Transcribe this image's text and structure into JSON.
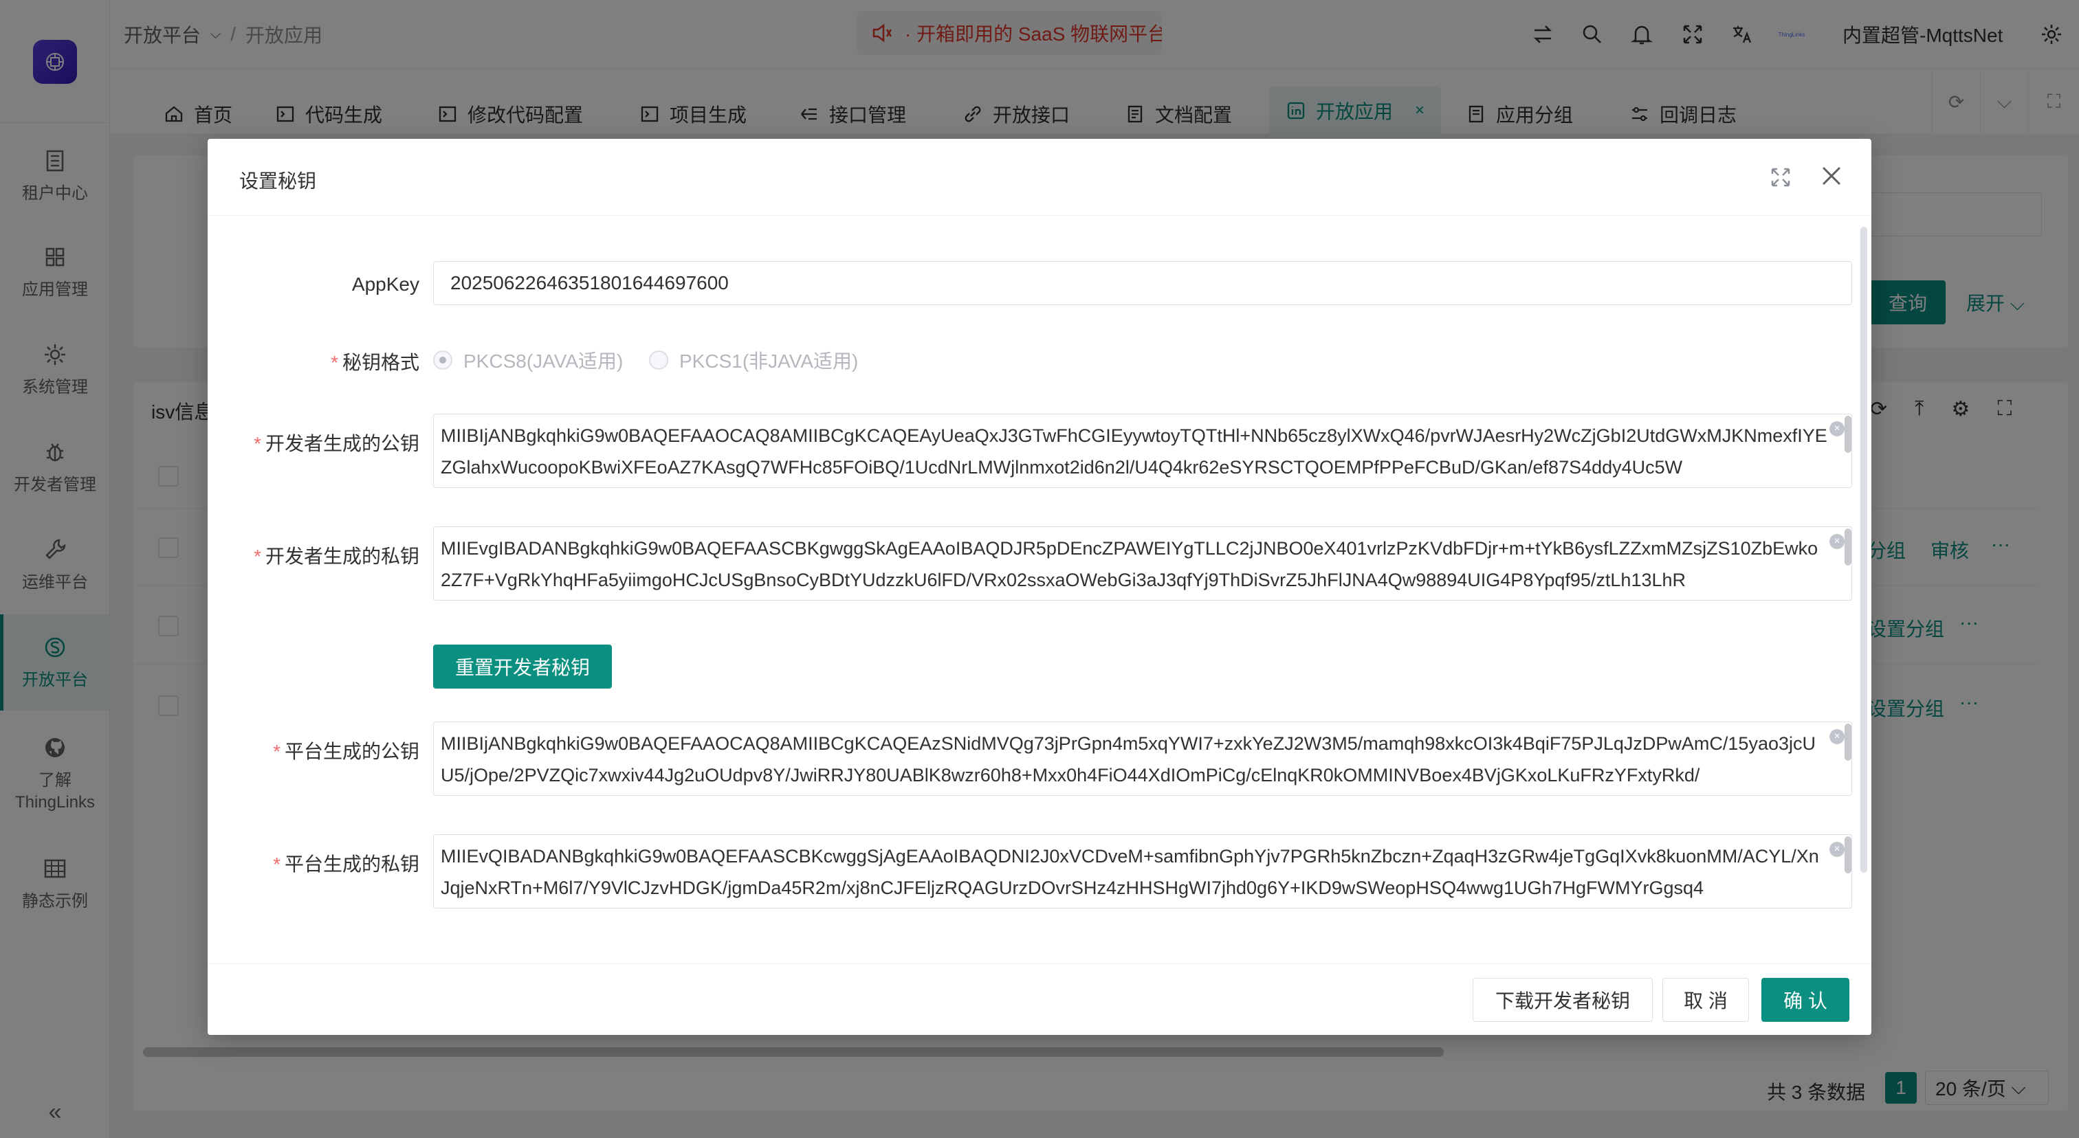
{
  "sidebar": {
    "items": [
      {
        "label": "租户中心",
        "icon": "building-icon"
      },
      {
        "label": "应用管理",
        "icon": "apps-icon"
      },
      {
        "label": "系统管理",
        "icon": "gear-icon"
      },
      {
        "label": "开发者管理",
        "icon": "bug-icon"
      },
      {
        "label": "运维平台",
        "icon": "wrench-icon"
      },
      {
        "label": "开放平台",
        "icon": "open-platform-icon"
      },
      {
        "label": "了解\nThingLinks",
        "icon": "github-icon"
      },
      {
        "label": "静态示例",
        "icon": "grid-icon"
      }
    ],
    "active_index": 5,
    "collapse_glyph": "«"
  },
  "header": {
    "breadcrumb": [
      "开放平台",
      "开放应用"
    ],
    "notice": "· 开箱即用的 SaaS 物联网平台，快速接入 · 稳定",
    "username": "内置超管-MqttsNet",
    "avatar_text": "ThingLinks"
  },
  "tabs": [
    {
      "label": "首页"
    },
    {
      "label": "代码生成"
    },
    {
      "label": "修改代码配置"
    },
    {
      "label": "项目生成"
    },
    {
      "label": "接口管理"
    },
    {
      "label": "开放接口"
    },
    {
      "label": "文档配置"
    },
    {
      "label": "开放应用",
      "active": true
    },
    {
      "label": "应用分组"
    },
    {
      "label": "回调日志"
    }
  ],
  "background": {
    "isv_title": "isv信息",
    "query_label": "查询",
    "expand_label": "展开",
    "row_links": [
      "分组",
      "审核",
      "设置分组",
      "设置分组"
    ],
    "more": "···",
    "total": "共 3 条数据",
    "page": "1",
    "page_size": "20 条/页"
  },
  "modal": {
    "title": "设置秘钥",
    "app_key_label": "AppKey",
    "app_key_value": "20250622646351801644697600",
    "format_label": "秘钥格式",
    "format_options": [
      "PKCS8(JAVA适用)",
      "PKCS1(非JAVA适用)"
    ],
    "format_selected": 0,
    "dev_public_label": "开发者生成的公钥",
    "dev_public_value": "MIIBIjANBgkqhkiG9w0BAQEFAAOCAQ8AMIIBCgKCAQEAyUeaQxJ3GTwFhCGIEyywtoyTQTtHl+NNb65cz8ylXWxQ46/pvrWJAesrHy2WcZjGbI2UtdGWxMJKNmexfIYEZGlahxWucoopoKBwiXFEoAZ7KAsgQ7WFHc85FOiBQ/1UcdNrLMWjlnmxot2id6n2l/U4Q4kr62eSYRSCTQOEMPfPPeFCBuD/GKan/ef87S4ddy4Uc5W",
    "dev_private_label": "开发者生成的私钥",
    "dev_private_value": "MIIEvgIBADANBgkqhkiG9w0BAQEFAASCBKgwggSkAgEAAoIBAQDJR5pDEncZPAWEIYgTLLC2jJNBO0eX401vrlzPzKVdbFDjr+m+tYkB6ysfLZZxmMZsjZS10ZbEwko2Z7F+VgRkYhqHFa5yiimgoHCJcUSgBnsoCyBDtYUdzzkU6lFD/VRx02ssxaOWebGi3aJ3qfYj9ThDiSvrZ5JhFlJNA4Qw98894UIG4P8Ypqf95/ztLh13LhR",
    "reset_label": "重置开发者秘钥",
    "plat_public_label": "平台生成的公钥",
    "plat_public_value": "MIIBIjANBgkqhkiG9w0BAQEFAAOCAQ8AMIIBCgKCAQEAzSNidMVQg73jPrGpn4m5xqYWI7+zxkYeZJ2W3M5/mamqh98xkcOI3k4BqiF75PJLqJzDPwAmC/15yao3jcUU5/jOpe/2PVZQic7xwxiv44Jg2uOUdpv8Y/JwiRRJY80UABlK8wzr60h8+Mxx0h4FiO44XdIOmPiCg/cElnqKR0kOMMINVBoex4BVjGKxoLKuFRzYFxtyRkd/",
    "plat_private_label": "平台生成的私钥",
    "plat_private_value": "MIIEvQIBADANBgkqhkiG9w0BAQEFAASCBKcwggSjAgEAAoIBAQDNI2J0xVCDveM+samfibnGphYjv7PGRh5knZbczn+ZqaqH3zGRw4jeTgGqIXvk8kuonMM/ACYL/XnJqjeNxRTn+M6l7/Y9VlCJzvHDGK/jgmDa45R2m/xj8nCJFEljzRQAGUrzDOvrSHz4zHHSHgWI7jhd0g6Y+IKD9wSWeopHSQ4wwg1UGh7HgFWMYrGgsq4",
    "download_label": "下载开发者秘钥",
    "cancel_label": "取 消",
    "confirm_label": "确 认"
  },
  "colors": {
    "accent": "#0a8f80",
    "required": "#f56c6c",
    "notice": "#e0362c",
    "logo": "#4b2ed0"
  }
}
